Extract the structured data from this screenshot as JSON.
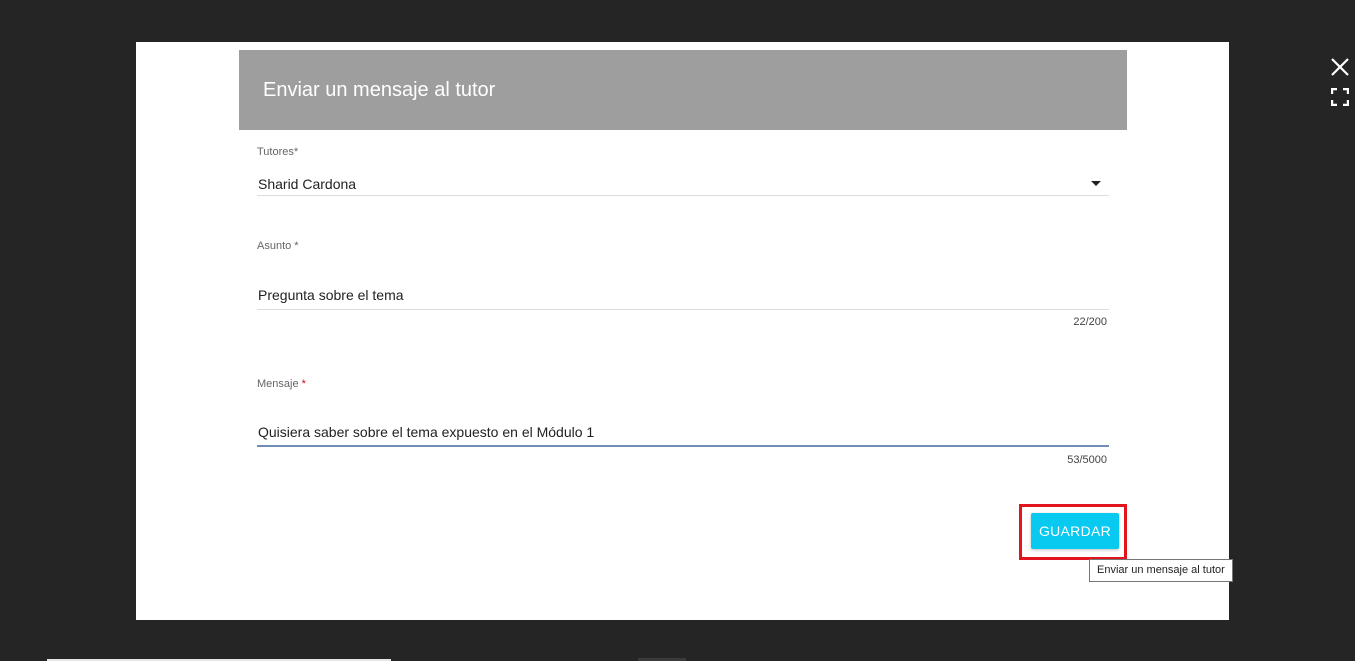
{
  "modal": {
    "title": "Enviar un mensaje al tutor"
  },
  "form": {
    "tutor": {
      "label": "Tutores*",
      "value": "Sharid Cardona"
    },
    "subject": {
      "label": "Asunto *",
      "value": "Pregunta sobre el tema",
      "counter": "22/200"
    },
    "message": {
      "label": "Mensaje",
      "required_mark": "*",
      "value": "Quisiera saber sobre el tema expuesto en el Módulo 1",
      "counter": "53/5000"
    }
  },
  "actions": {
    "save_label": "GUARDAR",
    "save_tooltip": "Enviar un mensaje al tutor"
  },
  "colors": {
    "header_bg": "#9e9e9e",
    "accent_button": "#08c9f0",
    "highlight_box": "#e3141e",
    "overlay_bg": "#252525"
  },
  "icons": {
    "close": "close-icon",
    "fullscreen": "fullscreen-icon",
    "dropdown": "dropdown-arrow-icon"
  }
}
